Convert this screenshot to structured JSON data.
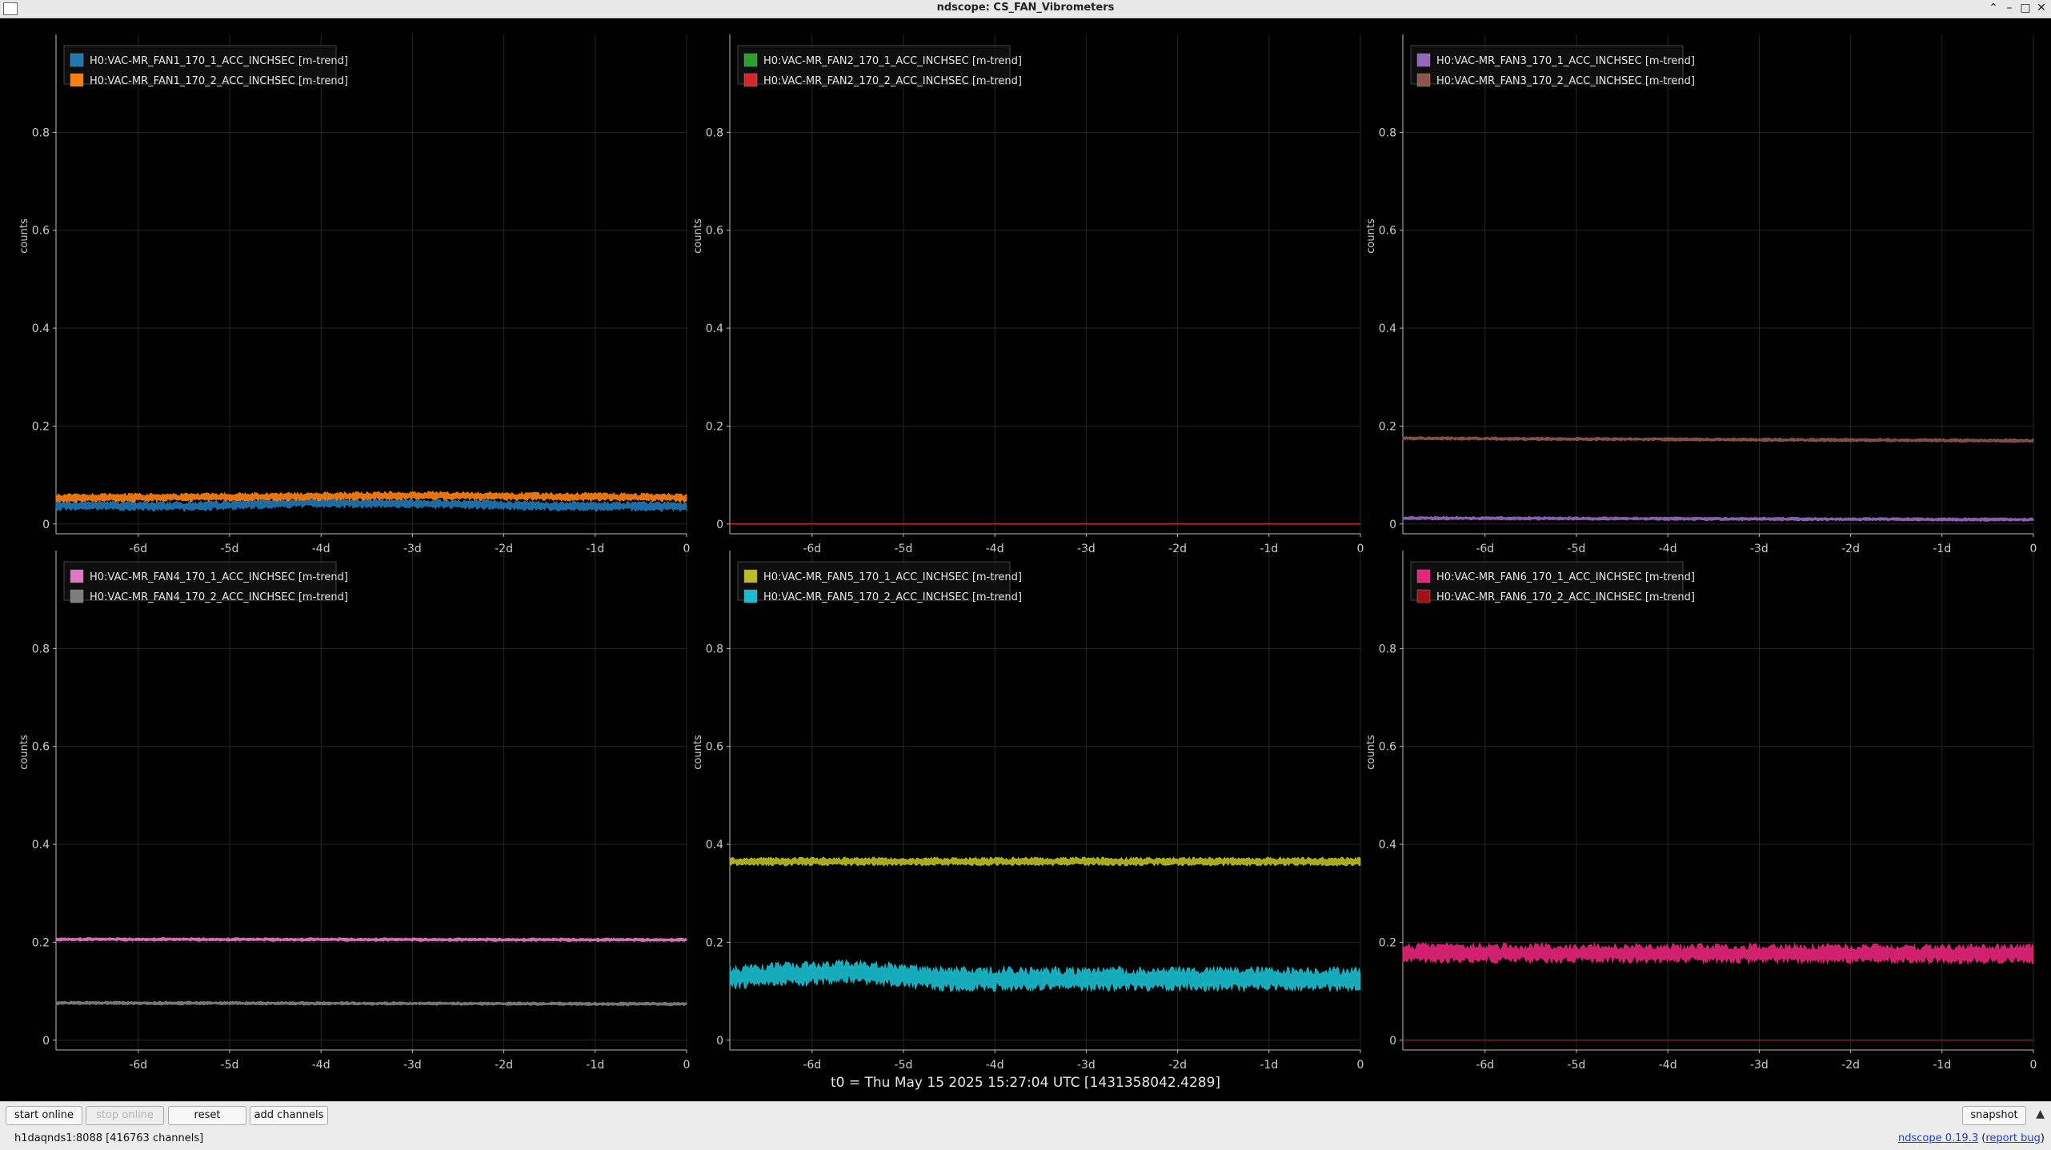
{
  "window": {
    "title": "ndscope: CS_FAN_Vibrometers"
  },
  "chart_data": [
    {
      "type": "line",
      "ylabel": "counts",
      "xticks": [
        "-6d",
        "-5d",
        "-4d",
        "-3d",
        "-2d",
        "-1d",
        "0"
      ],
      "yticks": [
        "0",
        "0.2",
        "0.4",
        "0.6",
        "0.8"
      ],
      "ylim": [
        -0.02,
        1.0
      ],
      "xlim": [
        -6.9,
        0
      ],
      "series": [
        {
          "name": "H0:VAC-MR_FAN1_170_1_ACC_INCHSEC [m-trend]",
          "color": "#1f77b4",
          "level": [
            [
              -6.9,
              0.038
            ],
            [
              -5.4,
              0.036
            ],
            [
              -4.3,
              0.043
            ],
            [
              -3,
              0.042
            ],
            [
              -1.5,
              0.037
            ],
            [
              0,
              0.036
            ]
          ],
          "noise": 0.008
        },
        {
          "name": "H0:VAC-MR_FAN1_170_2_ACC_INCHSEC [m-trend]",
          "color": "#ff7f0e",
          "level": [
            [
              -6.9,
              0.053
            ],
            [
              -4.3,
              0.056
            ],
            [
              -3,
              0.058
            ],
            [
              0,
              0.054
            ]
          ],
          "noise": 0.007
        }
      ]
    },
    {
      "type": "line",
      "ylabel": "counts",
      "xticks": [
        "-6d",
        "-5d",
        "-4d",
        "-3d",
        "-2d",
        "-1d",
        "0"
      ],
      "yticks": [
        "0",
        "0.2",
        "0.4",
        "0.6",
        "0.8"
      ],
      "ylim": [
        -0.02,
        1.0
      ],
      "xlim": [
        -6.9,
        0
      ],
      "series": [
        {
          "name": "H0:VAC-MR_FAN2_170_1_ACC_INCHSEC [m-trend]",
          "color": "#2ca02c",
          "level": [
            [
              -6.9,
              0.0
            ],
            [
              0,
              0.0
            ]
          ],
          "noise": 0.0
        },
        {
          "name": "H0:VAC-MR_FAN2_170_2_ACC_INCHSEC [m-trend]",
          "color": "#d62728",
          "level": [
            [
              -6.9,
              0.0
            ],
            [
              0,
              0.0
            ]
          ],
          "noise": 0.0
        }
      ]
    },
    {
      "type": "line",
      "ylabel": "counts",
      "xticks": [
        "-6d",
        "-5d",
        "-4d",
        "-3d",
        "-2d",
        "-1d",
        "0"
      ],
      "yticks": [
        "0",
        "0.2",
        "0.4",
        "0.6",
        "0.8"
      ],
      "ylim": [
        -0.02,
        1.0
      ],
      "xlim": [
        -6.9,
        0
      ],
      "series": [
        {
          "name": "H0:VAC-MR_FAN3_170_1_ACC_INCHSEC [m-trend]",
          "color": "#9467bd",
          "level": [
            [
              -6.9,
              0.012
            ],
            [
              0,
              0.009
            ]
          ],
          "noise": 0.003
        },
        {
          "name": "H0:VAC-MR_FAN3_170_2_ACC_INCHSEC [m-trend]",
          "color": "#8c564b",
          "level": [
            [
              -6.9,
              0.175
            ],
            [
              0,
              0.17
            ]
          ],
          "noise": 0.003
        }
      ]
    },
    {
      "type": "line",
      "ylabel": "counts",
      "xticks": [
        "-6d",
        "-5d",
        "-4d",
        "-3d",
        "-2d",
        "-1d",
        "0"
      ],
      "yticks": [
        "0",
        "0.2",
        "0.4",
        "0.6",
        "0.8"
      ],
      "ylim": [
        -0.02,
        1.0
      ],
      "xlim": [
        -6.9,
        0
      ],
      "series": [
        {
          "name": "H0:VAC-MR_FAN4_170_1_ACC_INCHSEC [m-trend]",
          "color": "#e377c2",
          "level": [
            [
              -6.9,
              0.206
            ],
            [
              0,
              0.205
            ]
          ],
          "noise": 0.003
        },
        {
          "name": "H0:VAC-MR_FAN4_170_2_ACC_INCHSEC [m-trend]",
          "color": "#7f7f7f",
          "level": [
            [
              -6.9,
              0.076
            ],
            [
              0,
              0.074
            ]
          ],
          "noise": 0.003
        }
      ]
    },
    {
      "type": "line",
      "ylabel": "counts",
      "xticks": [
        "-6d",
        "-5d",
        "-4d",
        "-3d",
        "-2d",
        "-1d",
        "0"
      ],
      "yticks": [
        "0",
        "0.2",
        "0.4",
        "0.6",
        "0.8"
      ],
      "ylim": [
        -0.02,
        1.0
      ],
      "xlim": [
        -6.9,
        0
      ],
      "series": [
        {
          "name": "H0:VAC-MR_FAN5_170_1_ACC_INCHSEC [m-trend]",
          "color": "#bcbd22",
          "level": [
            [
              -6.9,
              0.365
            ],
            [
              0,
              0.365
            ]
          ],
          "noise": 0.007
        },
        {
          "name": "H0:VAC-MR_FAN5_170_2_ACC_INCHSEC [m-trend]",
          "color": "#17becf",
          "level": [
            [
              -6.9,
              0.13
            ],
            [
              -5.6,
              0.14
            ],
            [
              -4.5,
              0.125
            ],
            [
              0,
              0.125
            ]
          ],
          "noise": 0.02
        }
      ]
    },
    {
      "type": "line",
      "ylabel": "counts",
      "xticks": [
        "-6d",
        "-5d",
        "-4d",
        "-3d",
        "-2d",
        "-1d",
        "0"
      ],
      "yticks": [
        "0",
        "0.2",
        "0.4",
        "0.6",
        "0.8"
      ],
      "ylim": [
        -0.02,
        1.0
      ],
      "xlim": [
        -6.9,
        0
      ],
      "series": [
        {
          "name": "H0:VAC-MR_FAN6_170_1_ACC_INCHSEC [m-trend]",
          "color": "#e8247a",
          "level": [
            [
              -6.9,
              0.178
            ],
            [
              0,
              0.176
            ]
          ],
          "noise": 0.016
        },
        {
          "name": "H0:VAC-MR_FAN6_170_2_ACC_INCHSEC [m-trend]",
          "color": "#a50f15",
          "level": [
            [
              -6.9,
              0.0
            ],
            [
              0,
              0.0
            ]
          ],
          "noise": 0.0
        }
      ]
    }
  ],
  "t0_label": "t0 = Thu May 15 2025 15:27:04 UTC [1431358042.4289]",
  "toolbar": {
    "start_online": "start online",
    "stop_online": "stop online",
    "reset": "reset",
    "add_channels": "add channels",
    "snapshot": "snapshot"
  },
  "status": {
    "server": "h1daqnds1:8088  [416763 channels]",
    "version_link": "ndscope 0.19.3",
    "report_bug": "report bug"
  },
  "colors": {
    "background": "#000000",
    "grid": "#2a2a2a",
    "axis": "#cccccc"
  }
}
